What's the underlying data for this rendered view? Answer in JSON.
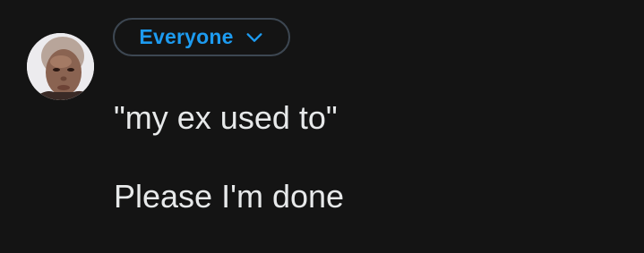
{
  "audience": {
    "label": "Everyone",
    "icon": "chevron-down-icon"
  },
  "user": {
    "avatar": "profile-photo"
  },
  "post": {
    "line1": "\"my ex used to\"",
    "line2": "Please I'm done"
  },
  "colors": {
    "background": "#141414",
    "accent": "#1d9bf0",
    "border": "#3d4752",
    "text": "#e7e9ea"
  }
}
